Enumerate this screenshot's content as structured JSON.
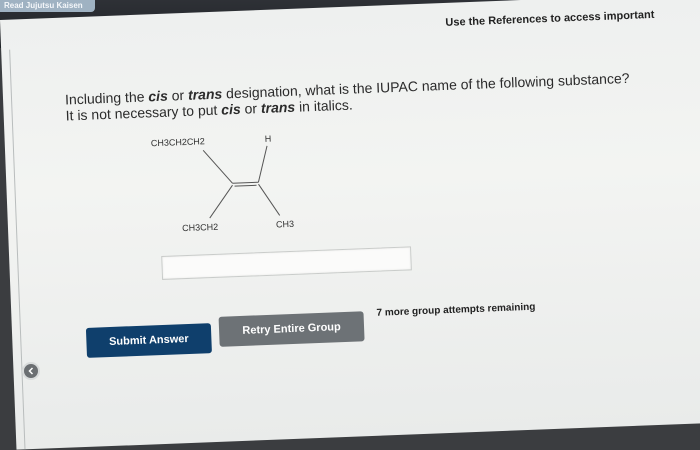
{
  "browser": {
    "tab_label": "Read Jujutsu Kaisen"
  },
  "assignment": {
    "references_text": "Use the References to access important",
    "question_line1_prefix": "Including the ",
    "cis": "cis",
    "or": " or ",
    "trans": "trans",
    "question_line1_suffix": " designation, what is the IUPAC name of the following substance?",
    "question_line2_prefix": "It is not necessary to put ",
    "question_line2_suffix": " in italics."
  },
  "molecule": {
    "top_left": "CH3CH2CH2",
    "top_right": "H",
    "bottom_left": "CH3CH2",
    "bottom_right": "CH3"
  },
  "answer": {
    "value": ""
  },
  "actions": {
    "submit_label": "Submit Answer",
    "retry_label": "Retry Entire Group",
    "attempts_text": "7 more group attempts remaining"
  },
  "colors": {
    "submit": "#0f3f6c",
    "retry": "#6d7276",
    "page": "#eef0ef"
  }
}
